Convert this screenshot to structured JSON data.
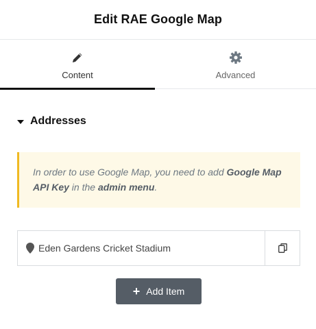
{
  "header": {
    "title": "Edit RAE Google Map"
  },
  "tabs": [
    {
      "label": "Content",
      "icon": "pencil-icon",
      "active": true
    },
    {
      "label": "Advanced",
      "icon": "gear-icon",
      "active": false
    }
  ],
  "section": {
    "title": "Addresses",
    "expanded": true
  },
  "notice": {
    "text_1": "In order to use Google Map, you need to add ",
    "bold_1": "Google Map API Key",
    "text_2": " in the ",
    "bold_2": "admin menu",
    "text_3": "."
  },
  "addresses": [
    {
      "label": "Eden Gardens Cricket Stadium",
      "icon": "map-pin-icon"
    }
  ],
  "add_item": {
    "label": "Add Item",
    "icon": "plus-icon"
  },
  "colors": {
    "notice_bg": "#fef9e7",
    "notice_border": "#f0b922",
    "button_bg": "#555d66",
    "active_tab_underline": "#111111"
  }
}
